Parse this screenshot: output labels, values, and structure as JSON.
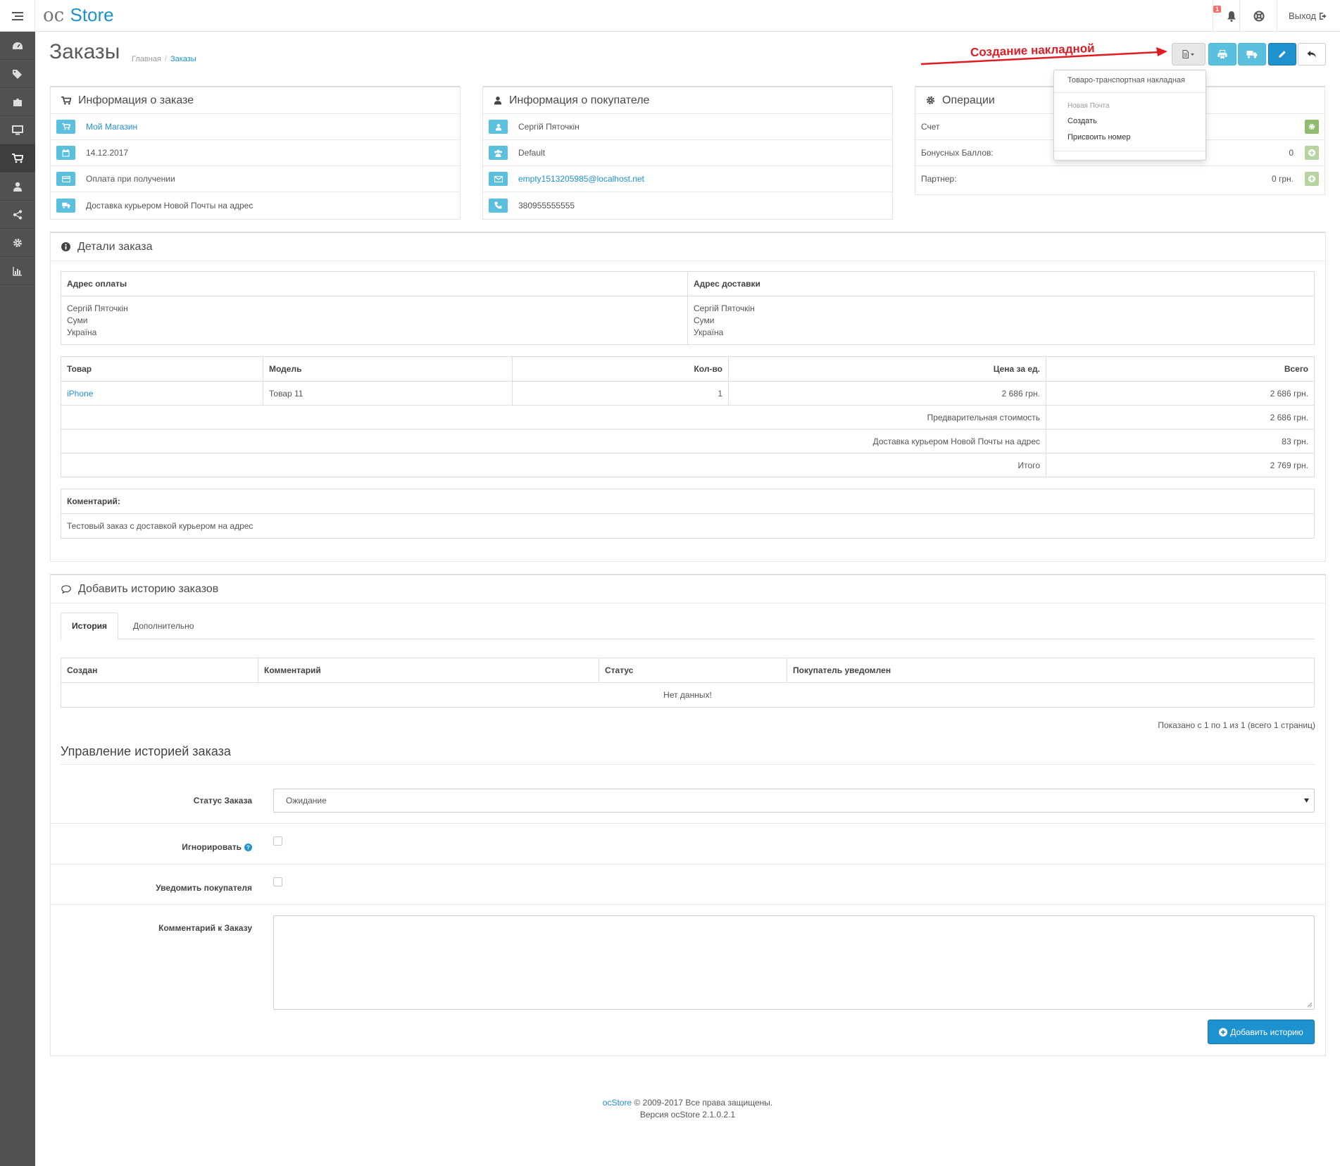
{
  "header": {
    "logo_oc": "oc",
    "logo_store": "Store",
    "notification_count": "1",
    "logout_label": "Выход"
  },
  "page": {
    "title": "Заказы",
    "breadcrumb": [
      "Главная",
      "Заказы"
    ],
    "annotation": "Создание накладной"
  },
  "dropdown": {
    "item_ttn": "Товаро-транспортная накладная",
    "header_np": "Новая Почта",
    "item_create": "Создать",
    "item_assign": "Присвоить номер"
  },
  "order_info": {
    "title": "Информация о заказе",
    "store": "Мой Магазин",
    "date": "14.12.2017",
    "payment": "Оплата при получении",
    "shipping": "Доставка курьером Новой Почты на адрес"
  },
  "customer_info": {
    "title": "Информация о покупателе",
    "name": "Сергій Пяточкін",
    "group": "Default",
    "email": "empty1513205985@localhost.net",
    "phone": "380955555555"
  },
  "operations": {
    "title": "Операции",
    "invoice_label": "Счет",
    "bonus_label": "Бонусных Баллов:",
    "bonus_value": "0",
    "affiliate_label": "Партнер:",
    "affiliate_value": "0 грн."
  },
  "details": {
    "title": "Детали заказа",
    "payment_address_label": "Адрес оплаты",
    "shipping_address_label": "Адрес доставки",
    "payment_address": [
      "Сергій Пяточкін",
      "Суми",
      "Україна"
    ],
    "shipping_address": [
      "Сергій Пяточкін",
      "Суми",
      "Україна"
    ],
    "columns": [
      "Товар",
      "Модель",
      "Кол-во",
      "Цена за ед.",
      "Всего"
    ],
    "product": {
      "name": "iPhone",
      "model": "Товар 11",
      "qty": "1",
      "price": "2 686 грн.",
      "total": "2 686 грн."
    },
    "totals": [
      {
        "label": "Предварительная стоимость",
        "value": "2 686 грн."
      },
      {
        "label": "Доставка курьером Новой Почты на адрес",
        "value": "83 грн."
      },
      {
        "label": "Итого",
        "value": "2 769 грн."
      }
    ],
    "comment_label": "Коментарий:",
    "comment": "Тестовый заказ с доставкой курьером на адрес"
  },
  "history": {
    "title": "Добавить историю заказов",
    "tab_history": "История",
    "tab_additional": "Дополнительно",
    "columns": [
      "Создан",
      "Комментарий",
      "Статус",
      "Покупатель уведомлен"
    ],
    "empty": "Нет данных!",
    "pagination": "Показано с 1 по 1 из 1 (всего 1 страниц)",
    "manage_title": "Управление историей заказа",
    "status_label": "Статус Заказа",
    "status_value": "Ожидание",
    "ignore_label": "Игнорировать",
    "notify_label": "Уведомить покупателя",
    "comment_label": "Комментарий к Заказу",
    "add_button": "Добавить историю"
  },
  "footer": {
    "brand": "ocStore",
    "copyright": "© 2009-2017 Все права защищены.",
    "version": "Версия ocStore 2.1.0.2.1"
  },
  "colors": {
    "accent": "#1e91cf",
    "info": "#5bc0de",
    "sidebar": "#515151",
    "annotation": "#e01b24",
    "success": "#8fbb6c"
  }
}
